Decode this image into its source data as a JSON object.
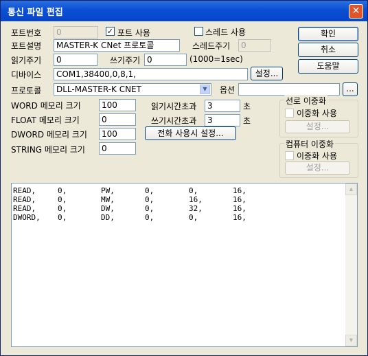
{
  "window": {
    "title": "통신 파일 편집",
    "close_glyph": "✕"
  },
  "form": {
    "port_no": {
      "label": "포트번호",
      "value": "0"
    },
    "port_use": {
      "label": "포트 사용",
      "checked": true
    },
    "thread_use": {
      "label": "스레드 사용",
      "checked": false
    },
    "port_desc": {
      "label": "포트설명",
      "value": "MASTER-K CNet 프로토콜"
    },
    "thread_cycle": {
      "label": "스레드주기",
      "value": "0"
    },
    "read_cycle": {
      "label": "읽기주기",
      "value": "0"
    },
    "write_cycle": {
      "label": "쓰기주기",
      "value": "0"
    },
    "cycle_unit": "(1000=1sec)",
    "device": {
      "label": "디바이스",
      "value": "COM1,38400,0,8,1,",
      "button": "설정..."
    },
    "protocol": {
      "label": "프로토콜",
      "value": "DLL-MASTER-K CNET",
      "arrow": "▼"
    },
    "option": {
      "label": "옵션",
      "value": "",
      "button": "..."
    },
    "word_mem": {
      "label": "WORD 메모리 크기",
      "value": "100"
    },
    "float_mem": {
      "label": "FLOAT 메모리 크기",
      "value": "0"
    },
    "dword_mem": {
      "label": "DWORD 메모리 크기",
      "value": "100"
    },
    "string_mem": {
      "label": "STRING 메모리 크기",
      "value": "0"
    },
    "read_timeout": {
      "label": "읽기시간초과",
      "value": "3",
      "unit": "초"
    },
    "write_timeout": {
      "label": "쓰기시간초과",
      "value": "3",
      "unit": "초"
    },
    "phone_setup": "전화 사용시 설정..."
  },
  "buttons": {
    "ok": "확인",
    "cancel": "취소",
    "help": "도움말"
  },
  "line_redundancy": {
    "title": "선로 이중화",
    "use_label": "이중화 사용",
    "settings": "설정..."
  },
  "computer_redundancy": {
    "title": "컴퓨터 이중화",
    "use_label": "이중화 사용",
    "settings": "설정..."
  },
  "list": {
    "rows": [
      [
        "READ,",
        "0,",
        "PW,",
        "0,",
        "0,",
        "16,"
      ],
      [
        "READ,",
        "0,",
        "MW,",
        "0,",
        "16,",
        "16,"
      ],
      [
        "READ,",
        "0,",
        "DW,",
        "0,",
        "32,",
        "16,"
      ],
      [
        "DWORD,",
        "0,",
        "DD,",
        "0,",
        "0,",
        "16,"
      ]
    ],
    "scroll_up": "▲",
    "scroll_down": "▼"
  }
}
